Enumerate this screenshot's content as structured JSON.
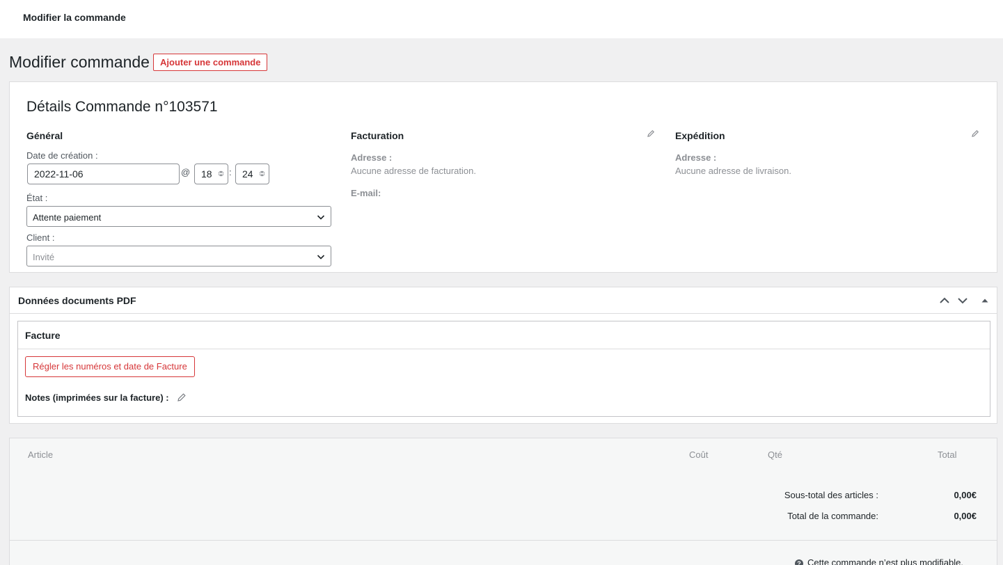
{
  "topbar": {
    "title": "Modifier la commande"
  },
  "page": {
    "heading": "Modifier commande",
    "add_button": "Ajouter une commande"
  },
  "order": {
    "title": "Détails Commande n°103571",
    "general": {
      "heading": "Général",
      "date_label": "Date de création :",
      "date_value": "2022-11-06",
      "at": "@",
      "hour": "18",
      "colon": ":",
      "minute": "24",
      "status_label": "État :",
      "status_value": "Attente paiement",
      "client_label": "Client :",
      "client_placeholder": "Invité"
    },
    "billing": {
      "heading": "Facturation",
      "address_label": "Adresse :",
      "address_value": "Aucune adresse de facturation.",
      "email_label": "E-mail:"
    },
    "shipping": {
      "heading": "Expédition",
      "address_label": "Adresse :",
      "address_value": "Aucune adresse de livraison."
    }
  },
  "pdf": {
    "heading": "Données documents PDF",
    "invoice_heading": "Facture",
    "set_button": "Régler les numéros et date de Facture",
    "notes_label": "Notes (imprimées sur la facture) :"
  },
  "items": {
    "columns": [
      "Article",
      "Coût",
      "Qté",
      "Total"
    ],
    "subtotal_label": "Sous-total des articles :",
    "subtotal_value": "0,00€",
    "total_label": "Total de la commande:",
    "total_value": "0,00€",
    "locked_message": "Cette commande n’est plus modifiable."
  },
  "colors": {
    "accent_red": "#d63638",
    "muted": "#8c8f94",
    "background": "#f0f0f1"
  },
  "icons": [
    "pencil-icon",
    "chevron-up-icon",
    "chevron-down-icon",
    "triangle-up-icon",
    "help-icon",
    "spinner-arrows-icon"
  ]
}
